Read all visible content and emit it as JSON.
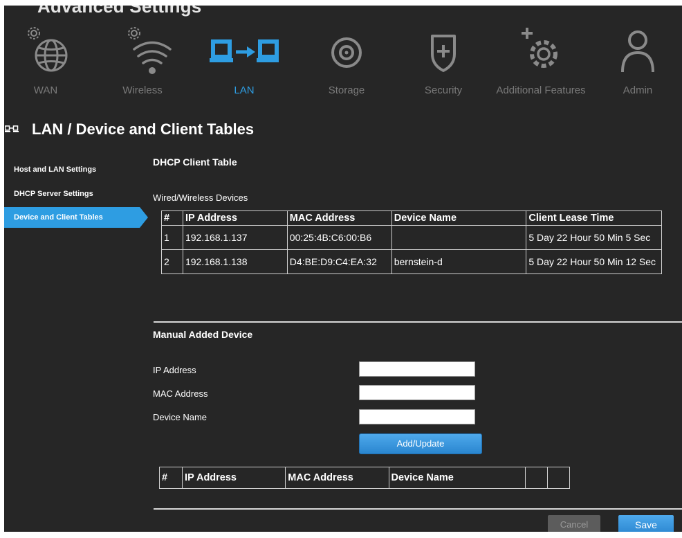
{
  "app": {
    "title": "Advanced Settings"
  },
  "nav": {
    "items": [
      {
        "label": "WAN",
        "icon": "globe-gear-icon"
      },
      {
        "label": "Wireless",
        "icon": "wifi-gear-icon"
      },
      {
        "label": "LAN",
        "icon": "lan-icon",
        "active": true
      },
      {
        "label": "Storage",
        "icon": "disk-icon"
      },
      {
        "label": "Security",
        "icon": "shield-plus-icon"
      },
      {
        "label": "Additional Features",
        "icon": "gear-plus-icon"
      },
      {
        "label": "Admin",
        "icon": "user-icon"
      }
    ]
  },
  "page": {
    "title": "LAN / Device and Client Tables"
  },
  "sidebar": {
    "items": [
      {
        "label": "Host and LAN Settings"
      },
      {
        "label": "DHCP Server Settings"
      },
      {
        "label": "Device and Client Tables",
        "active": true
      }
    ]
  },
  "dhcp": {
    "title": "DHCP Client Table",
    "subtitle": "Wired/Wireless Devices",
    "headers": [
      "#",
      "IP Address",
      "MAC Address",
      "Device Name",
      "Client Lease Time"
    ],
    "rows": [
      [
        "1",
        "192.168.1.137",
        "00:25:4B:C6:00:B6",
        "",
        "5 Day 22 Hour 50 Min 5 Sec"
      ],
      [
        "2",
        "192.168.1.138",
        "D4:BE:D9:C4:EA:32",
        "bernstein-d",
        "5 Day 22 Hour 50 Min 12 Sec"
      ]
    ]
  },
  "manual": {
    "title": "Manual Added Device",
    "ip_label": "IP Address",
    "mac_label": "MAC Address",
    "name_label": "Device Name",
    "ip_value": "",
    "mac_value": "",
    "name_value": "",
    "add_update_label": "Add/Update",
    "headers": [
      "#",
      "IP Address",
      "MAC Address",
      "Device Name",
      "",
      ""
    ]
  },
  "footer": {
    "cancel_label": "Cancel",
    "save_label": "Save"
  },
  "colors": {
    "accent": "#2e9de2",
    "background": "#262626",
    "inactive": "#7a7a7a"
  }
}
